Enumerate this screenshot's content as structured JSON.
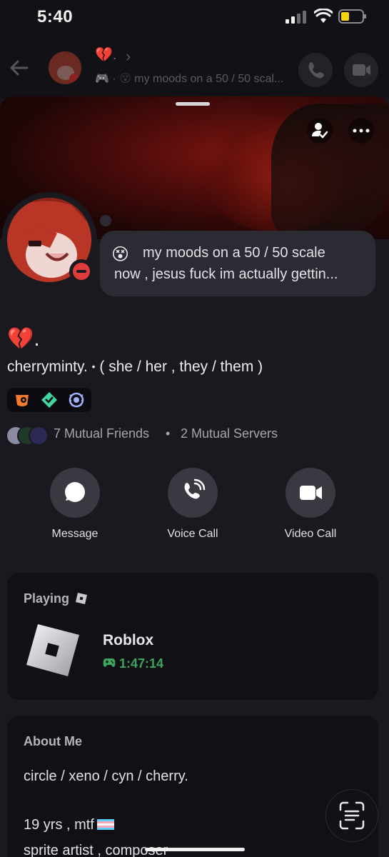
{
  "status_bar": {
    "time": "5:40"
  },
  "dm_header": {
    "name_emoji": "💔.",
    "chevron": "›",
    "status_text": "my moods on a 50 / 50 scal..."
  },
  "profile": {
    "custom_status": {
      "emoji": "😵",
      "line1": "my moods on a 50 / 50 scale",
      "line2": "now , jesus fuck im actually gettin..."
    },
    "display_name": "💔.",
    "username": "cherryminty.",
    "separator": "•",
    "pronouns": "( she / her , they / them )",
    "mutual_friends": "7 Mutual Friends",
    "mutual_dot": "•",
    "mutual_servers": "2 Mutual Servers"
  },
  "actions": [
    {
      "label": "Message"
    },
    {
      "label": "Voice Call"
    },
    {
      "label": "Video Call"
    }
  ],
  "playing": {
    "section_label": "Playing",
    "game_name": "Roblox",
    "elapsed": "1:47:14"
  },
  "about": {
    "section_label": "About Me",
    "line1": "circle / xeno / cyn / cherry.",
    "line2": "19 yrs , mtf",
    "line3": "sprite artist , composer"
  },
  "colors": {
    "accent_green": "#3ba55d",
    "dnd_red": "#e03b3b",
    "background": "#1a191f"
  },
  "icons": [
    "back-arrow-icon",
    "phone-icon",
    "video-camera-icon",
    "add-friend-icon",
    "more-icon",
    "message-bubble-icon",
    "gamepad-icon",
    "roblox-icon",
    "scan-text-icon"
  ]
}
